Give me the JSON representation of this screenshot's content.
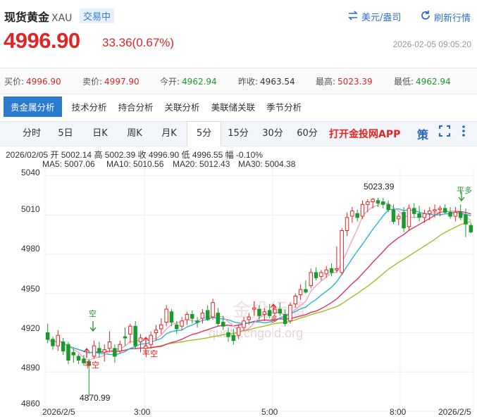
{
  "header": {
    "title": "现货黄金",
    "code": "XAU",
    "status": "交易中",
    "unit_link": "美元/盎司",
    "refresh_link": "刷新行情"
  },
  "quote": {
    "price": "4996.90",
    "change": "33.36(0.67%)",
    "timestamp": "2026-02-05 09:05:20"
  },
  "stats": [
    {
      "label": "买价:",
      "value": "4996.90",
      "color": "red"
    },
    {
      "label": "卖价:",
      "value": "4997.90",
      "color": "red"
    },
    {
      "label": "今开:",
      "value": "4962.94",
      "color": "green"
    },
    {
      "label": "昨收:",
      "value": "4963.54",
      "color": "dark"
    },
    {
      "label": "最高:",
      "value": "5023.39",
      "color": "red"
    },
    {
      "label": "最低:",
      "value": "4962.94",
      "color": "green"
    }
  ],
  "analysis_tabs": [
    "贵金属分析",
    "技术分析",
    "持合分析",
    "关联分析",
    "美联储关联",
    "季节分析"
  ],
  "period_tabs": [
    "分时",
    "5日",
    "日K",
    "周K",
    "月K",
    "5分",
    "15分",
    "30分",
    "60分"
  ],
  "active_period": "5分",
  "promo": "打开金投网APP",
  "strategy_glyph": "策",
  "ohlc_line": "2026/02/05  开 5002.14  高 5002.39  收 4996.90  低 4996.55  幅 -0.10%",
  "ma_legend": [
    {
      "text": "MA5: 5007.06",
      "color": "#f4a3bd"
    },
    {
      "text": "MA10: 5010.56",
      "color": "#28b6d6"
    },
    {
      "text": "MA20: 5012.43",
      "color": "#e0306a"
    },
    {
      "text": "MA30: 5004.38",
      "color": "#9fbe24"
    }
  ],
  "chart_labels": {
    "high": "5023.39",
    "low": "4870.99",
    "watermark": "quote.cngold.org",
    "notes": [
      "空",
      "平空",
      "平空",
      "多",
      "平多"
    ]
  },
  "colors": {
    "up": "#e12424",
    "down": "#1a9a2c",
    "accent": "#2a7bd0"
  },
  "chart_data": {
    "type": "candlestick",
    "y_ticks": [
      4860,
      4890,
      4920,
      4950,
      4980,
      5010,
      5040
    ],
    "ylim": [
      4860,
      5044
    ],
    "x_ticks": [
      "2026/2/5",
      "3:00",
      "5:00",
      "8:00",
      "2026/2/5"
    ],
    "candles": [
      [
        4920,
        4927,
        4912,
        4915
      ],
      [
        4915,
        4917,
        4907,
        4910
      ],
      [
        4910,
        4922,
        4906,
        4918
      ],
      [
        4913,
        4916,
        4903,
        4906
      ],
      [
        4911,
        4913,
        4896,
        4899
      ],
      [
        4905,
        4908,
        4897,
        4903
      ],
      [
        4902,
        4904,
        4896,
        4899
      ],
      [
        4900,
        4903,
        4895,
        4897
      ],
      [
        4898,
        4900,
        4871,
        4895
      ],
      [
        4902,
        4914,
        4900,
        4910
      ],
      [
        4908,
        4913,
        4901,
        4905
      ],
      [
        4905,
        4911,
        4898,
        4907
      ],
      [
        4908,
        4921,
        4905,
        4913
      ],
      [
        4908,
        4911,
        4897,
        4902
      ],
      [
        4906,
        4914,
        4904,
        4911
      ],
      [
        4917,
        4924,
        4910,
        4916
      ],
      [
        4919,
        4927,
        4912,
        4925
      ],
      [
        4925,
        4929,
        4908,
        4910
      ],
      [
        4913,
        4919,
        4905,
        4916
      ],
      [
        4908,
        4912,
        4904,
        4910
      ],
      [
        4911,
        4921,
        4908,
        4918
      ],
      [
        4920,
        4926,
        4914,
        4922
      ],
      [
        4923,
        4931,
        4919,
        4926
      ],
      [
        4928,
        4941,
        4925,
        4938
      ],
      [
        4936,
        4938,
        4925,
        4928
      ],
      [
        4926,
        4929,
        4919,
        4923
      ],
      [
        4925,
        4932,
        4922,
        4929
      ],
      [
        4930,
        4936,
        4926,
        4934
      ],
      [
        4934,
        4937,
        4927,
        4931
      ],
      [
        4929,
        4932,
        4924,
        4928
      ],
      [
        4931,
        4938,
        4927,
        4935
      ],
      [
        4937,
        4941,
        4929,
        4930
      ],
      [
        4932,
        4946,
        4930,
        4943
      ],
      [
        4935,
        4939,
        4925,
        4927
      ],
      [
        4928,
        4933,
        4922,
        4925
      ],
      [
        4920,
        4924,
        4913,
        4917
      ],
      [
        4918,
        4923,
        4911,
        4914
      ],
      [
        4918,
        4926,
        4915,
        4924
      ],
      [
        4924,
        4932,
        4921,
        4929
      ],
      [
        4930,
        4935,
        4926,
        4932
      ],
      [
        4938,
        4944,
        4933,
        4939
      ],
      [
        4938,
        4941,
        4930,
        4933
      ],
      [
        4934,
        4939,
        4929,
        4936
      ],
      [
        4937,
        4942,
        4931,
        4933
      ],
      [
        4935,
        4940,
        4933,
        4938
      ],
      [
        4938,
        4943,
        4933,
        4935
      ],
      [
        4934,
        4938,
        4925,
        4927
      ],
      [
        4929,
        4943,
        4927,
        4941
      ],
      [
        4942,
        4950,
        4939,
        4948
      ],
      [
        4949,
        4957,
        4945,
        4953
      ],
      [
        4953,
        4960,
        4950,
        4951
      ],
      [
        4956,
        4969,
        4954,
        4966
      ],
      [
        4966,
        4970,
        4960,
        4962
      ],
      [
        4963,
        4968,
        4960,
        4966
      ],
      [
        4965,
        4971,
        4962,
        4968
      ],
      [
        4969,
        4973,
        4963,
        4966
      ],
      [
        4968,
        4986,
        4966,
        4969
      ],
      [
        4966,
        5000,
        4964,
        4998
      ],
      [
        4998,
        5012,
        4994,
        5008
      ],
      [
        5009,
        5016,
        5004,
        5013
      ],
      [
        5011,
        5014,
        5005,
        5008
      ],
      [
        5009,
        5021,
        5007,
        5018
      ],
      [
        5018,
        5022,
        5012,
        5020
      ],
      [
        5020,
        5023,
        5015,
        5022
      ],
      [
        5021,
        5023,
        5016,
        5019
      ],
      [
        5020,
        5023,
        5015,
        5018
      ],
      [
        5018,
        5021,
        5012,
        5014
      ],
      [
        5014,
        5018,
        5003,
        5005
      ],
      [
        5007,
        5011,
        5002,
        5009
      ],
      [
        5012,
        5016,
        4997,
        5000
      ],
      [
        5001,
        5018,
        4998,
        5015
      ],
      [
        5015,
        5019,
        5008,
        5011
      ],
      [
        5011,
        5017,
        5005,
        5008
      ],
      [
        5008,
        5014,
        5004,
        5011
      ],
      [
        5011,
        5016,
        5006,
        5013
      ],
      [
        5013,
        5018,
        5008,
        5014
      ],
      [
        5014,
        5017,
        5009,
        5015
      ],
      [
        5015,
        5018,
        5011,
        5012
      ],
      [
        5012,
        5016,
        5007,
        5009
      ],
      [
        5009,
        5016,
        5005,
        5012
      ],
      [
        5012,
        5018,
        5006,
        5008
      ],
      [
        5010,
        5015,
        4993,
        5003
      ],
      [
        5002,
        5004,
        4996,
        4997
      ]
    ]
  }
}
